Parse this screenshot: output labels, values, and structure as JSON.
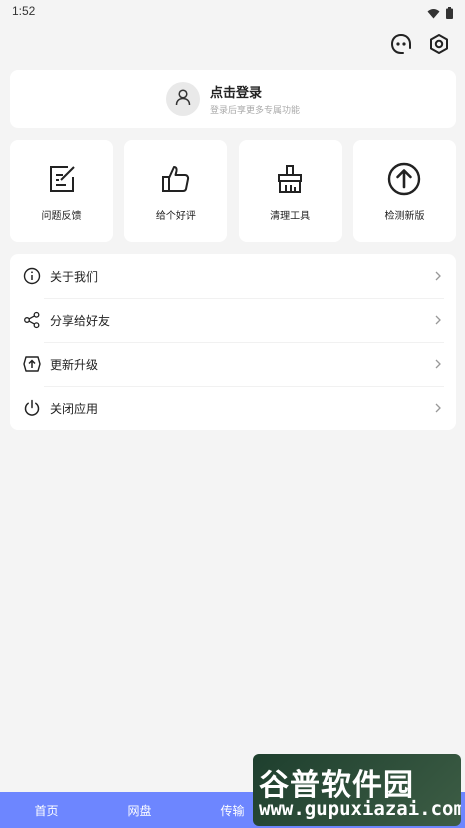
{
  "status_bar": {
    "time": "1:52"
  },
  "top_actions": [
    {
      "icon": "robot-icon",
      "name": "assistant-button"
    },
    {
      "icon": "hexagon-settings-icon",
      "name": "settings-button"
    }
  ],
  "login": {
    "title": "点击登录",
    "subtitle": "登录后享更多专属功能"
  },
  "grid_items": [
    {
      "label": "问题反馈",
      "icon": "edit-note-icon"
    },
    {
      "label": "给个好评",
      "icon": "thumbs-up-icon"
    },
    {
      "label": "清理工具",
      "icon": "broom-icon"
    },
    {
      "label": "检测新版",
      "icon": "arrow-up-circle-icon"
    }
  ],
  "menu_items": [
    {
      "label": "关于我们",
      "icon": "info-icon"
    },
    {
      "label": "分享给好友",
      "icon": "share-icon"
    },
    {
      "label": "更新升级",
      "icon": "upgrade-icon"
    },
    {
      "label": "关闭应用",
      "icon": "power-icon"
    }
  ],
  "bottom_nav": [
    {
      "label": "首页"
    },
    {
      "label": "网盘"
    },
    {
      "label": "传输"
    }
  ],
  "watermark": {
    "title": "谷普软件园",
    "url": "www.gupuxiazai.com"
  },
  "colors": {
    "nav_bg": "#6d86ff",
    "card_bg": "#ffffff",
    "page_bg": "#f4f4f4"
  }
}
